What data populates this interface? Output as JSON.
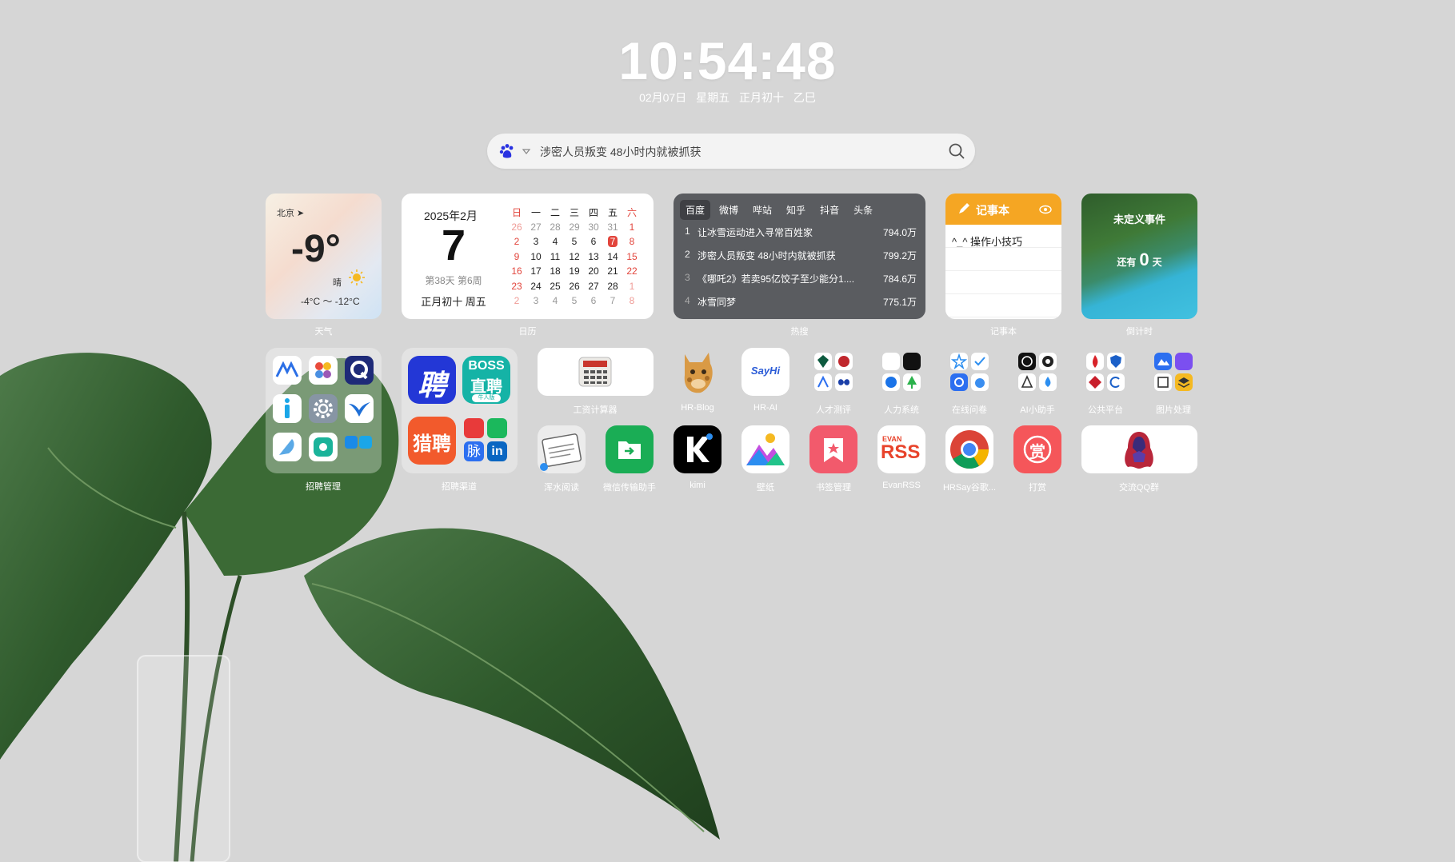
{
  "clock": {
    "time": "10:54:48"
  },
  "date": {
    "solar": "02月07日",
    "weekday": "星期五",
    "lunar": "正月初十",
    "ganzhi": "乙巳"
  },
  "search": {
    "query": "涉密人员叛变 48小时内就被抓获",
    "engine_icon": "baidu-paw-icon"
  },
  "weather": {
    "city": "北京",
    "temp": "-9°",
    "condition": "晴",
    "range": "-4°C ～ -12°C",
    "label": "天气"
  },
  "calendar": {
    "year_month": "2025年2月",
    "day": "7",
    "week_info": "第38天 第6周",
    "lunar": "正月初十 周五",
    "label": "日历",
    "weekday_headers": [
      "日",
      "一",
      "二",
      "三",
      "四",
      "五",
      "六"
    ],
    "weeks": [
      [
        "26",
        "27",
        "28",
        "29",
        "30",
        "31",
        "1"
      ],
      [
        "2",
        "3",
        "4",
        "5",
        "6",
        "7",
        "8"
      ],
      [
        "9",
        "10",
        "11",
        "12",
        "13",
        "14",
        "15"
      ],
      [
        "16",
        "17",
        "18",
        "19",
        "20",
        "21",
        "22"
      ],
      [
        "23",
        "24",
        "25",
        "26",
        "27",
        "28",
        "1"
      ],
      [
        "2",
        "3",
        "4",
        "5",
        "6",
        "7",
        "8"
      ]
    ],
    "today": "7"
  },
  "hot": {
    "label": "热搜",
    "tabs": [
      "百度",
      "微博",
      "哔站",
      "知乎",
      "抖音",
      "头条"
    ],
    "active_tab": "百度",
    "items": [
      {
        "rank": "1",
        "title": "让冰雪运动进入寻常百姓家",
        "value": "794.0万"
      },
      {
        "rank": "2",
        "title": "涉密人员叛变 48小时内就被抓获",
        "value": "799.2万"
      },
      {
        "rank": "3",
        "title": "《哪吒2》若卖95亿饺子至少能分1....",
        "value": "784.6万"
      },
      {
        "rank": "4",
        "title": "冰雪同梦",
        "value": "775.1万"
      }
    ]
  },
  "notes": {
    "title": "记事本",
    "item": "^_^ 操作小技巧",
    "label": "记事本"
  },
  "countdown": {
    "title": "未定义事件",
    "prefix": "还有",
    "value": "0",
    "suffix": "天",
    "label": "倒计时"
  },
  "apps": {
    "folder1": "招聘管理",
    "folder2": "招聘渠道",
    "salary": "工资计算器",
    "hrblog": "HR-Blog",
    "hrai": "HR-AI",
    "talent": "人才测评",
    "hrsys": "人力系统",
    "survey": "在线问卷",
    "ai": "AI小助手",
    "public": "公共平台",
    "image": "图片处理",
    "read": "浑水阅读",
    "wechat": "微信传输助手",
    "kimi": "kimi",
    "wallpaper": "壁纸",
    "bookmark": "书签管理",
    "rss": "EvanRSS",
    "chrome": "HRSay谷歌...",
    "reward": "打赏",
    "qq": "交流QQ群",
    "boss_text": "BOSS",
    "boss_sub": "直聘",
    "boss_tag": "牛人版",
    "pin_text": "聘",
    "liepin_text": "猎聘",
    "maimai_text": "脉",
    "linkedin_text": "in",
    "sayhi_text": "SayHi",
    "rss_top": "EVAN",
    "rss_main": "RSS",
    "reward_char": "赏"
  }
}
